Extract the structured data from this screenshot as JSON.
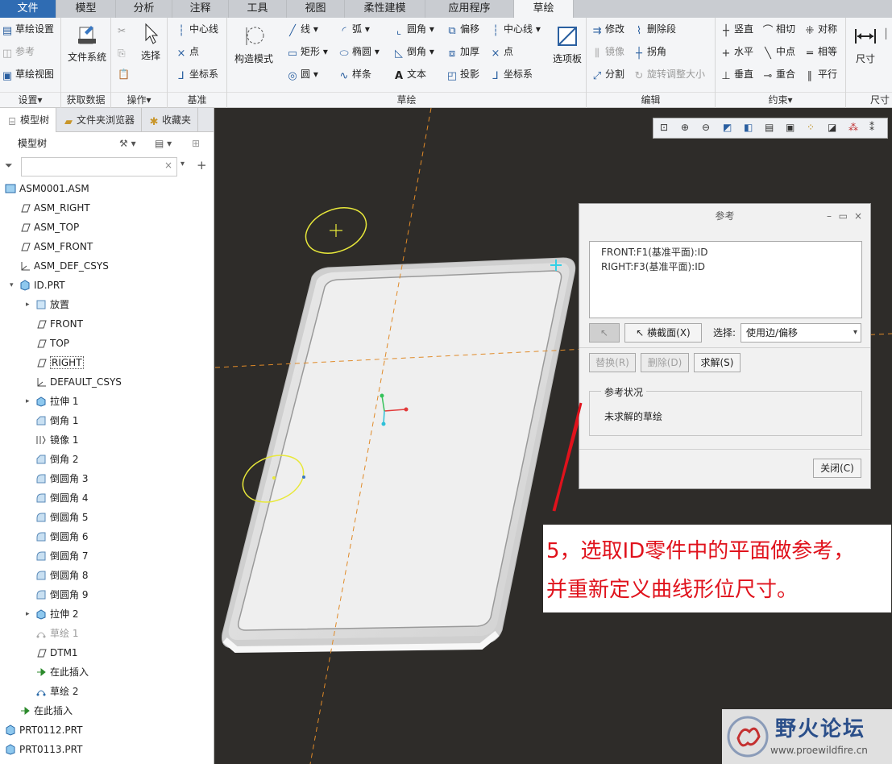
{
  "tabs": [
    "文件",
    "模型",
    "分析",
    "注释",
    "工具",
    "视图",
    "柔性建模",
    "应用程序",
    "草绘"
  ],
  "ribbon": {
    "setup": {
      "items": [
        "草绘设置",
        "参考",
        "草绘视图"
      ],
      "label": "设置▾"
    },
    "getdata": {
      "item": "文件系统",
      "label": "获取数据"
    },
    "ops": {
      "item": "选择",
      "label": "操作▾"
    },
    "datum": {
      "items": [
        "中心线",
        "点",
        "坐标系"
      ],
      "label": "基准"
    },
    "construct": {
      "item": "构造模式"
    },
    "sketch": {
      "col1": [
        "线",
        "矩形",
        "圆"
      ],
      "col2": [
        "弧",
        "椭圆",
        "样条"
      ],
      "col3": [
        "圆角",
        "倒角",
        "文本"
      ],
      "col4": [
        "偏移",
        "加厚",
        "投影"
      ],
      "col5": [
        "中心线",
        "点",
        "坐标系"
      ],
      "palette": "选项板",
      "label": "草绘"
    },
    "edit": {
      "items": [
        "修改",
        "删除段",
        "镜像",
        "拐角",
        "分割",
        "旋转调整大小"
      ],
      "label": "编辑"
    },
    "constrain": {
      "items": [
        "竖直",
        "相切",
        "对称",
        "水平",
        "中点",
        "相等",
        "垂直",
        "重合",
        "平行"
      ],
      "label": "约束▾"
    },
    "dim": {
      "item": "尺寸",
      "label": "尺寸"
    }
  },
  "panel": {
    "tabs": [
      "模型树",
      "文件夹浏览器",
      "收藏夹"
    ],
    "header": "模型树",
    "search_value": ""
  },
  "tree": [
    {
      "label": "ASM0001.ASM",
      "indent": 0,
      "icon": "asm",
      "dim": false
    },
    {
      "label": "ASM_RIGHT",
      "indent": 1,
      "icon": "plane",
      "dim": false
    },
    {
      "label": "ASM_TOP",
      "indent": 1,
      "icon": "plane",
      "dim": false
    },
    {
      "label": "ASM_FRONT",
      "indent": 1,
      "icon": "plane",
      "dim": false
    },
    {
      "label": "ASM_DEF_CSYS",
      "indent": 1,
      "icon": "csys",
      "dim": false
    },
    {
      "label": "ID.PRT",
      "indent": 1,
      "icon": "part",
      "dim": false,
      "open": true
    },
    {
      "label": "放置",
      "indent": 2,
      "icon": "place",
      "dim": false,
      "closed": true
    },
    {
      "label": "FRONT",
      "indent": 2,
      "icon": "plane",
      "dim": false
    },
    {
      "label": "TOP",
      "indent": 2,
      "icon": "plane",
      "dim": false
    },
    {
      "label": "RIGHT",
      "indent": 2,
      "icon": "plane",
      "dim": false
    },
    {
      "label": "DEFAULT_CSYS",
      "indent": 2,
      "icon": "csys",
      "dim": false
    },
    {
      "label": "拉伸 1",
      "indent": 2,
      "icon": "extrude",
      "dim": false,
      "closed": true
    },
    {
      "label": "倒角 1",
      "indent": 2,
      "icon": "chamfer",
      "dim": false
    },
    {
      "label": "镜像 1",
      "indent": 2,
      "icon": "mirror",
      "dim": false
    },
    {
      "label": "倒角 2",
      "indent": 2,
      "icon": "chamfer",
      "dim": false
    },
    {
      "label": "倒圆角 3",
      "indent": 2,
      "icon": "round",
      "dim": false
    },
    {
      "label": "倒圆角 4",
      "indent": 2,
      "icon": "round",
      "dim": false
    },
    {
      "label": "倒圆角 5",
      "indent": 2,
      "icon": "round",
      "dim": false
    },
    {
      "label": "倒圆角 6",
      "indent": 2,
      "icon": "round",
      "dim": false
    },
    {
      "label": "倒圆角 7",
      "indent": 2,
      "icon": "round",
      "dim": false
    },
    {
      "label": "倒圆角 8",
      "indent": 2,
      "icon": "round",
      "dim": false
    },
    {
      "label": "倒圆角 9",
      "indent": 2,
      "icon": "round",
      "dim": false
    },
    {
      "label": "拉伸 2",
      "indent": 2,
      "icon": "extrude",
      "dim": false,
      "closed": true
    },
    {
      "label": "草绘 1",
      "indent": 2,
      "icon": "sketch",
      "dim": true
    },
    {
      "label": "DTM1",
      "indent": 2,
      "icon": "plane",
      "dim": false
    },
    {
      "label": "在此插入",
      "indent": 2,
      "icon": "insert",
      "dim": false
    },
    {
      "label": "草绘 2",
      "indent": 2,
      "icon": "sketch2",
      "dim": false
    },
    {
      "label": "在此插入",
      "indent": 1,
      "icon": "insert",
      "dim": false
    },
    {
      "label": "PRT0112.PRT",
      "indent": 0,
      "icon": "part",
      "dim": false,
      "closed": true
    },
    {
      "label": "PRT0113.PRT",
      "indent": 0,
      "icon": "part",
      "dim": false,
      "closed": true
    }
  ],
  "dialog": {
    "title": "参考",
    "refs": [
      "FRONT:F1(基准平面):ID",
      "RIGHT:F3(基准平面):ID"
    ],
    "xsec_button": "横截面(X)",
    "select_label": "选择:",
    "select_value": "使用边/偏移",
    "replace": "替换(R)",
    "delete": "删除(D)",
    "solve": "求解(S)",
    "status_group": "参考状况",
    "status_text": "未求解的草绘",
    "close": "关闭(C)"
  },
  "annotation": {
    "line1": "5，选取ID零件中的平面做参考，",
    "line2": "并重新定义曲线形位尺寸。"
  },
  "watermark": {
    "title": "野火论坛",
    "url": "www.proewildfire.cn"
  },
  "colors": {
    "file_tab": "#2f6cb3",
    "sketch_yellow": "#e8e83a",
    "annotation_red": "#e0121c",
    "viewport_bg": "#2e2c29"
  }
}
